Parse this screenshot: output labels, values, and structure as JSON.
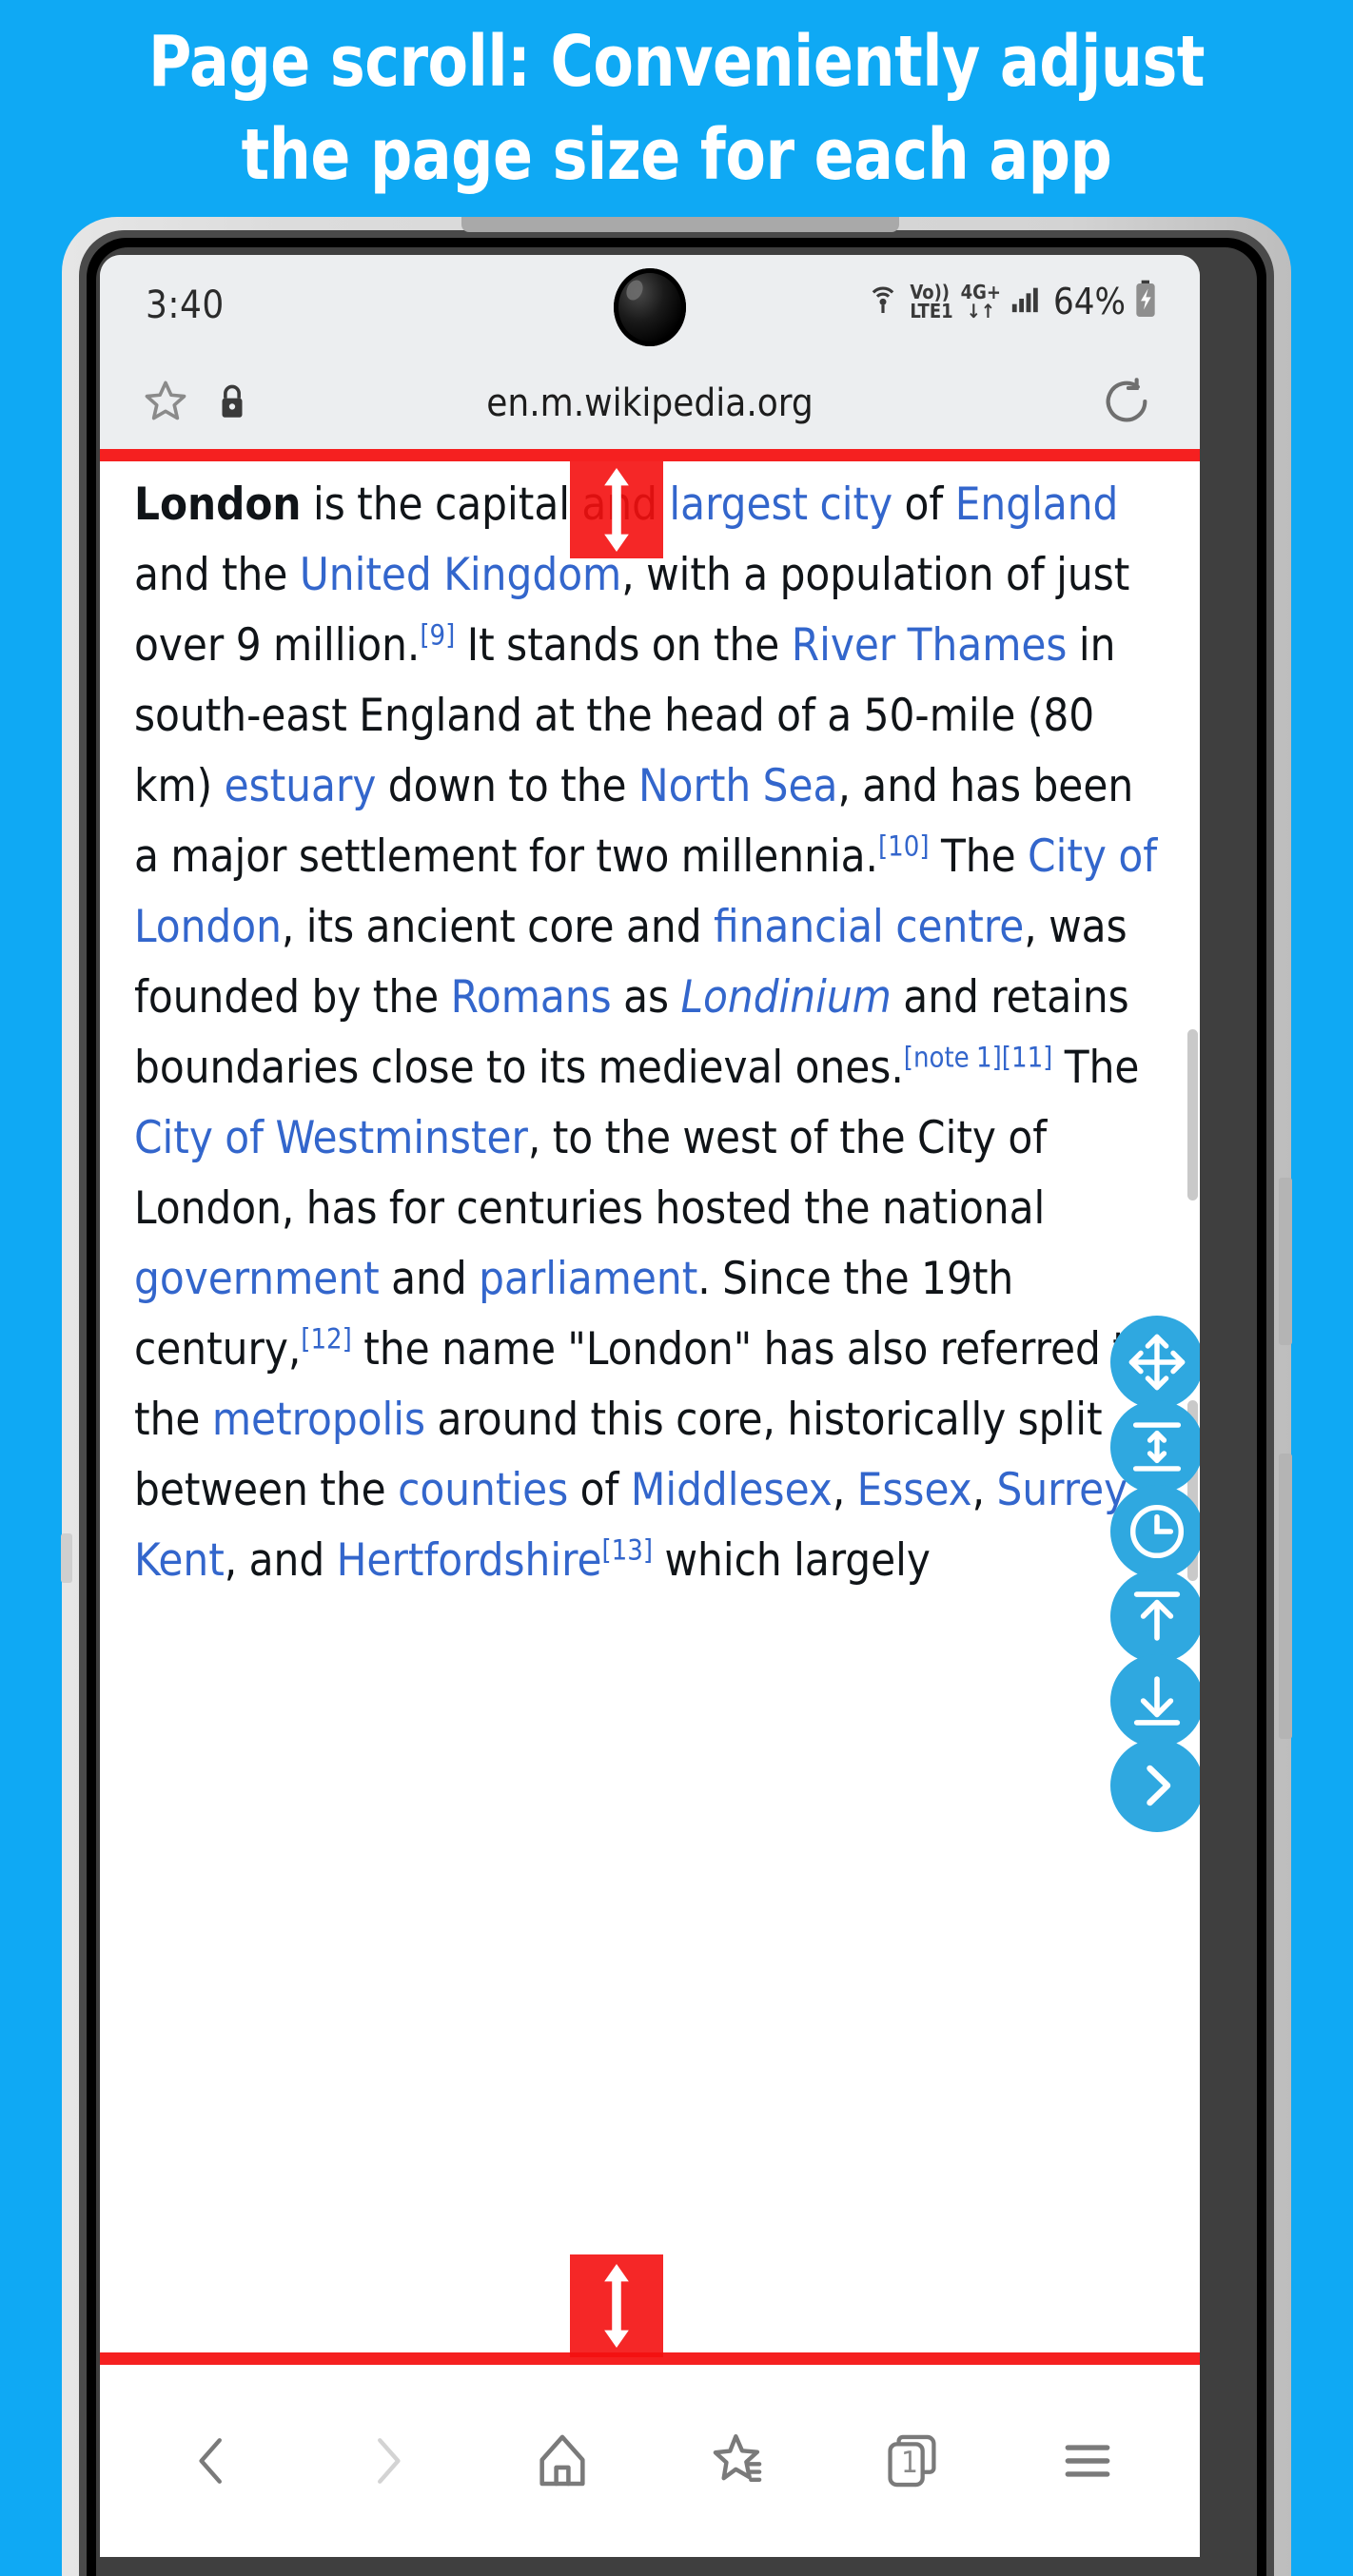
{
  "headline": {
    "line1": "Page scroll: Conveniently adjust",
    "line2": "the page size for each app"
  },
  "colors": {
    "background": "#0FA9F4",
    "fab": "#2FA8E0",
    "guide_red": "#F52020",
    "link_blue": "#3366cc",
    "chrome_gray": "#eceef0"
  },
  "status_bar": {
    "time": "3:40",
    "volte_top": "Vo))",
    "volte_bottom": "LTE1",
    "network": "4G+",
    "data_arrows": "↓↑",
    "battery_percent": "64%",
    "icons": [
      "hotspot-icon",
      "volte-icon",
      "network-4gplus-icon",
      "signal-bars-icon",
      "battery-charging-icon"
    ]
  },
  "browser": {
    "url": "en.m.wikipedia.org",
    "bookmark_icon": "star-icon",
    "security_icon": "lock-icon",
    "reload_icon": "reload-icon"
  },
  "article": {
    "segments": [
      {
        "t": "London",
        "s": "bold"
      },
      {
        "t": " is the capital and ",
        "s": "plain"
      },
      {
        "t": "largest city",
        "s": "link"
      },
      {
        "t": " of ",
        "s": "plain"
      },
      {
        "t": "England",
        "s": "link"
      },
      {
        "t": " and the ",
        "s": "plain"
      },
      {
        "t": "United Kingdom",
        "s": "link"
      },
      {
        "t": ", with a population of just over 9 million.",
        "s": "plain"
      },
      {
        "t": "[9]",
        "s": "sup"
      },
      {
        "t": " It stands on the ",
        "s": "plain"
      },
      {
        "t": "River Thames",
        "s": "link"
      },
      {
        "t": " in south-east England at the head of a 50-mile (80 km) ",
        "s": "plain"
      },
      {
        "t": "estuary",
        "s": "link"
      },
      {
        "t": " down to the ",
        "s": "plain"
      },
      {
        "t": "North Sea",
        "s": "link"
      },
      {
        "t": ", and has been a major settlement for two millennia.",
        "s": "plain"
      },
      {
        "t": "[10]",
        "s": "sup"
      },
      {
        "t": " The ",
        "s": "plain"
      },
      {
        "t": "City of London",
        "s": "link"
      },
      {
        "t": ", its ancient core and ",
        "s": "plain"
      },
      {
        "t": "financial centre",
        "s": "link"
      },
      {
        "t": ", was founded by the ",
        "s": "plain"
      },
      {
        "t": "Romans",
        "s": "link"
      },
      {
        "t": " as ",
        "s": "plain"
      },
      {
        "t": "Londinium",
        "s": "link-italic"
      },
      {
        "t": " and retains boundaries close to its medieval ones.",
        "s": "plain"
      },
      {
        "t": "[note 1][11]",
        "s": "sup"
      },
      {
        "t": " The ",
        "s": "plain"
      },
      {
        "t": "City of Westminster",
        "s": "link"
      },
      {
        "t": ", to the west of the City of London, has for centuries hosted the national ",
        "s": "plain"
      },
      {
        "t": "government",
        "s": "link"
      },
      {
        "t": " and ",
        "s": "plain"
      },
      {
        "t": "parliament",
        "s": "link"
      },
      {
        "t": ". Since the 19th century,",
        "s": "plain"
      },
      {
        "t": "[12]",
        "s": "sup"
      },
      {
        "t": " the name \"London\" has also referred to the ",
        "s": "plain"
      },
      {
        "t": "metropolis",
        "s": "link"
      },
      {
        "t": " around this core, historically split between the ",
        "s": "plain"
      },
      {
        "t": "counties",
        "s": "link"
      },
      {
        "t": " of ",
        "s": "plain"
      },
      {
        "t": "Middlesex",
        "s": "link"
      },
      {
        "t": ", ",
        "s": "plain"
      },
      {
        "t": "Essex",
        "s": "link"
      },
      {
        "t": ", ",
        "s": "plain"
      },
      {
        "t": "Surrey",
        "s": "link"
      },
      {
        "t": ", ",
        "s": "plain"
      },
      {
        "t": "Kent",
        "s": "link"
      },
      {
        "t": ", and ",
        "s": "plain"
      },
      {
        "t": "Hertfordshire",
        "s": "link"
      },
      {
        "t": "[13]",
        "s": "sup"
      },
      {
        "t": " which largely",
        "s": "plain"
      }
    ]
  },
  "overlay": {
    "top_handle_icon": "resize-vertical-handle-icon",
    "bottom_handle_icon": "resize-vertical-handle-icon"
  },
  "floating_buttons": [
    {
      "name": "move-button",
      "icon": "move-four-arrows-icon"
    },
    {
      "name": "resize-height-button",
      "icon": "resize-vertical-icon"
    },
    {
      "name": "history-button",
      "icon": "clock-icon"
    },
    {
      "name": "scroll-to-top-button",
      "icon": "arrow-up-to-line-icon"
    },
    {
      "name": "scroll-to-bottom-button",
      "icon": "arrow-down-to-line-icon"
    },
    {
      "name": "collapse-button",
      "icon": "chevron-right-icon"
    }
  ],
  "bottom_nav": [
    {
      "name": "back-button",
      "icon": "chevron-left-icon",
      "enabled": true
    },
    {
      "name": "forward-button",
      "icon": "chevron-right-icon",
      "enabled": false
    },
    {
      "name": "home-button",
      "icon": "home-icon",
      "enabled": true
    },
    {
      "name": "bookmarks-button",
      "icon": "bookmark-star-icon",
      "enabled": true
    },
    {
      "name": "tabs-button",
      "icon": "tabs-icon",
      "enabled": true,
      "count": "1"
    },
    {
      "name": "menu-button",
      "icon": "hamburger-menu-icon",
      "enabled": true
    }
  ]
}
